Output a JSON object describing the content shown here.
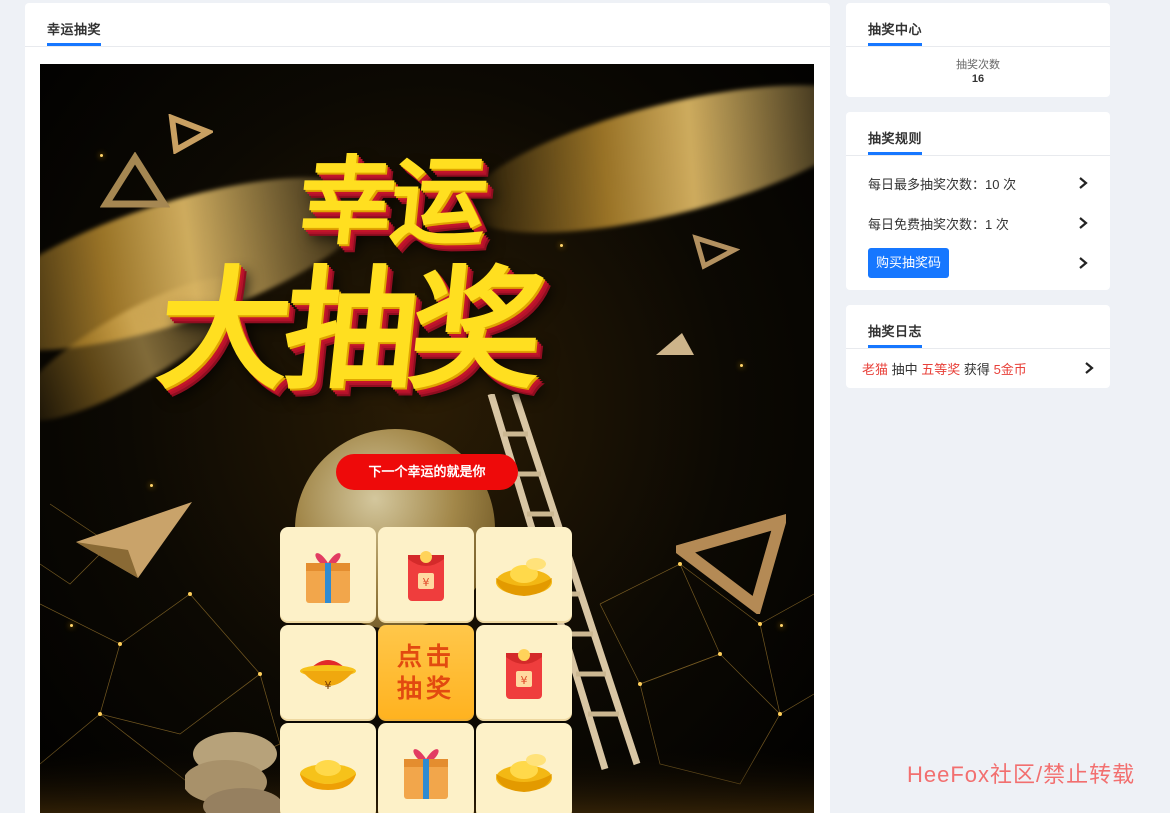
{
  "main": {
    "tab_title": "幸运抽奖",
    "banner": {
      "title_line1": "幸运",
      "title_line2": "大抽奖",
      "slogan": "下一个幸运的就是你",
      "center_button_line1": "点击",
      "center_button_line2": "抽奖",
      "prizes": [
        {
          "icon": "gift-box-icon"
        },
        {
          "icon": "red-envelope-icon"
        },
        {
          "icon": "gold-ingot-icon"
        },
        {
          "icon": "gold-bowl-icon"
        },
        {
          "icon": "draw-button"
        },
        {
          "icon": "red-envelope-icon"
        },
        {
          "icon": "gold-ingot-small-icon"
        },
        {
          "icon": "gift-box-icon"
        },
        {
          "icon": "gold-ingot-icon"
        }
      ]
    }
  },
  "center": {
    "title": "抽奖中心",
    "count_label": "抽奖次数",
    "count_value": "16"
  },
  "rules": {
    "title": "抽奖规则",
    "max_daily": "每日最多抽奖次数：10 次",
    "free_daily": "每日免费抽奖次数：1 次",
    "buy_button": "购买抽奖码"
  },
  "log": {
    "title": "抽奖日志",
    "entry": {
      "user": "老猫",
      "verb1": "抽中",
      "prize": "五等奖",
      "verb2": "获得",
      "reward": "5金币"
    }
  },
  "watermark": "HeeFox社区/禁止转载",
  "colors": {
    "accent": "#1677ff",
    "highlight_red": "#e8413a",
    "slogan_red": "#ee0a0a",
    "background": "#eef1f6"
  }
}
